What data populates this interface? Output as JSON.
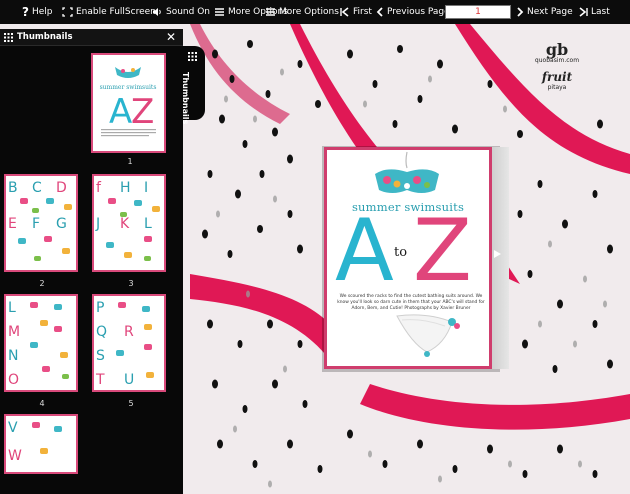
{
  "toolbar": {
    "help": "Help",
    "fullscreen": "Enable FullScreen",
    "sound": "Sound On",
    "more_options_1": "More Options",
    "more_options_2": "More Options",
    "first": "First",
    "previous": "Previous Page",
    "page_value": "1",
    "next": "Next Page",
    "last": "Last"
  },
  "thumbnails": {
    "title": "Thumbnails",
    "tab_label": "Thumbnails",
    "pages": [
      "1",
      "2",
      "3",
      "4",
      "5"
    ]
  },
  "cover": {
    "title": "summer swimsuits",
    "letter_a": "A",
    "letter_to": "to",
    "letter_z": "Z",
    "blurb": "We scoured the racks to find the cutest bathing suits around. We know you'll look so darn cute in them that your ABC's will stand for Adorn, Bem, and Cutie! Photographs by Xavier Bruner"
  },
  "logo": {
    "brand": "gb",
    "site": "quobasim.com",
    "name": "fruit",
    "sub": "pitaya"
  },
  "colors": {
    "accent_pink": "#d94a7b",
    "toolbar_bg": "#0c0c0c",
    "cyan": "#29b4cf"
  }
}
